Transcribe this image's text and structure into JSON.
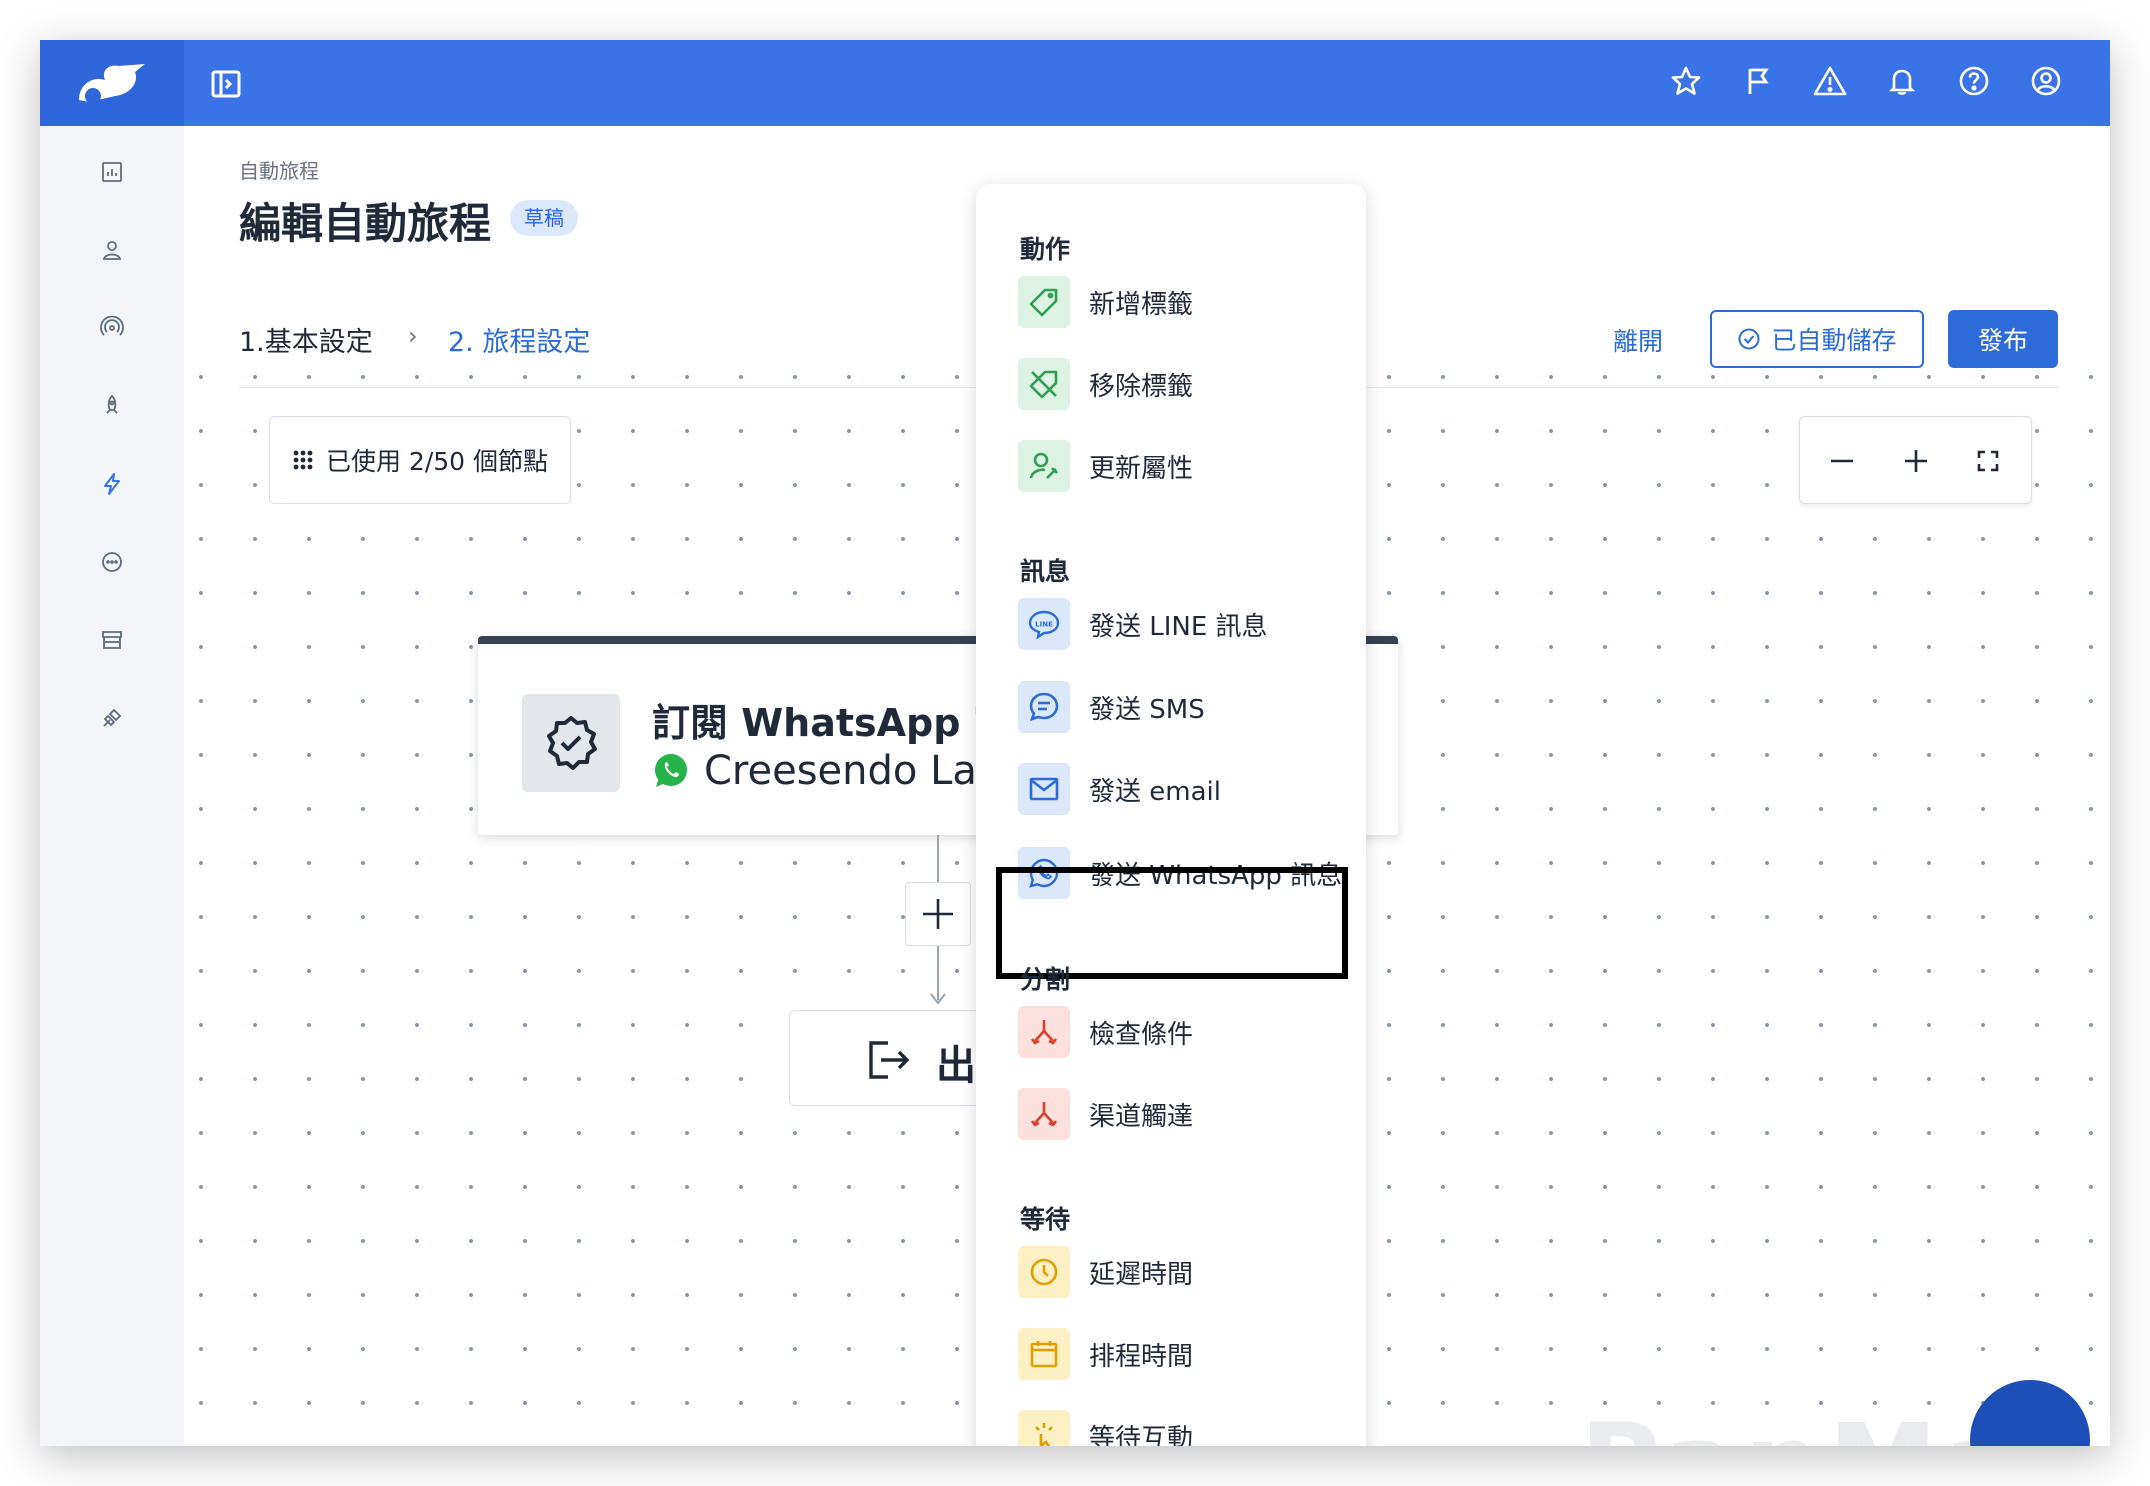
{
  "header": {
    "breadcrumb": "自動旅程",
    "title": "編輯自動旅程",
    "badge": "草稿",
    "step1": "1.基本設定",
    "step_sep": "›",
    "step2": "2. 旅程設定",
    "leave": "離開",
    "autosave": "已自動儲存",
    "publish": "發布"
  },
  "canvas": {
    "nodes_used": "已使用 2/50 個節點",
    "trigger_title": "訂閱 WhatsApp 官方",
    "trigger_subtitle": "Creesendo Lab",
    "exit_label": "出口"
  },
  "menu": {
    "sections": {
      "actions": "動作",
      "messages": "訊息",
      "split": "分割",
      "wait": "等待"
    },
    "items": {
      "add_tag": "新增標籤",
      "remove_tag": "移除標籤",
      "update_attr": "更新屬性",
      "send_line": "發送 LINE 訊息",
      "send_sms": "發送 SMS",
      "send_email": "發送 email",
      "send_whatsapp": "發送 WhatsApp 訊息",
      "check_condition": "檢查條件",
      "channel_reach": "渠道觸達",
      "delay_time": "延遲時間",
      "schedule_time": "排程時間",
      "wait_interaction": "等待互動"
    }
  },
  "colors": {
    "brand": "#3a73e6",
    "link": "#2d6bd8",
    "green": "#2e9e4f",
    "red": "#d9412e",
    "yellow": "#e0a000"
  }
}
